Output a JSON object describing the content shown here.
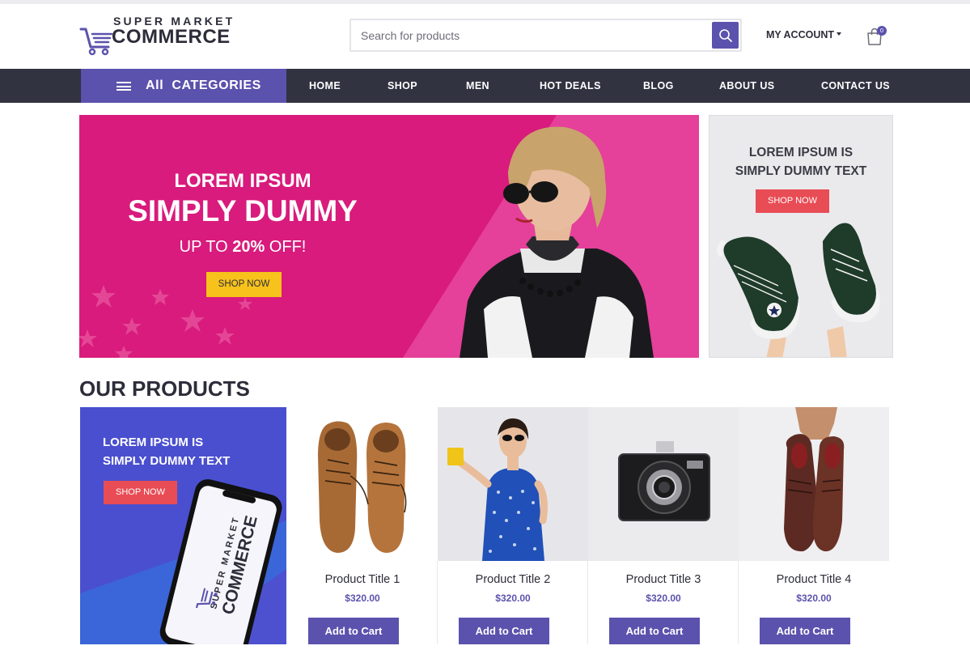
{
  "header": {
    "logo_top": "SUPER MARKET",
    "logo_main": "COMMERCE",
    "search_placeholder": "Search for products",
    "account_label": "MY ACCOUNT",
    "cart_count": "0"
  },
  "nav": {
    "categories_label": "All  CATEGORIES",
    "items": [
      "HOME",
      "SHOP",
      "MEN",
      "HOT DEALS",
      "BLOG",
      "ABOUT US",
      "CONTACT US"
    ]
  },
  "hero": {
    "line1": "LOREM IPSUM",
    "line2": "SIMPLY DUMMY",
    "offer_prefix": "UP TO ",
    "offer_value": "20%",
    "offer_suffix": " OFF!",
    "shop_label": "SHOP NOW"
  },
  "side_banner": {
    "line1": "LOREM IPSUM IS",
    "line2": "SIMPLY DUMMY TEXT",
    "shop_label": "SHOP NOW"
  },
  "products_section": {
    "title": "OUR PRODUCTS",
    "promo": {
      "line1": "LOREM IPSUM IS",
      "line2": "SIMPLY DUMMY TEXT",
      "shop_label": "SHOP NOW",
      "phone_logo_top": "SUPER MARKET",
      "phone_logo_main": "COMMERCE"
    },
    "products": [
      {
        "title": "Product Title 1",
        "price": "$320.00",
        "button": "Add to Cart",
        "image": "brown-leather-shoes"
      },
      {
        "title": "Product Title 2",
        "price": "$320.00",
        "button": "Add to Cart",
        "image": "woman-blue-dress"
      },
      {
        "title": "Product Title 3",
        "price": "$320.00",
        "button": "Add to Cart",
        "image": "vintage-camera"
      },
      {
        "title": "Product Title 4",
        "price": "$320.00",
        "button": "Add to Cart",
        "image": "worn-shoes-in-hand"
      }
    ]
  },
  "colors": {
    "accent": "#5b52ad",
    "nav_bg": "#313341",
    "hero_pink": "#d81b7c",
    "shop_yellow": "#f7c21b",
    "shop_red": "#e84c55"
  }
}
